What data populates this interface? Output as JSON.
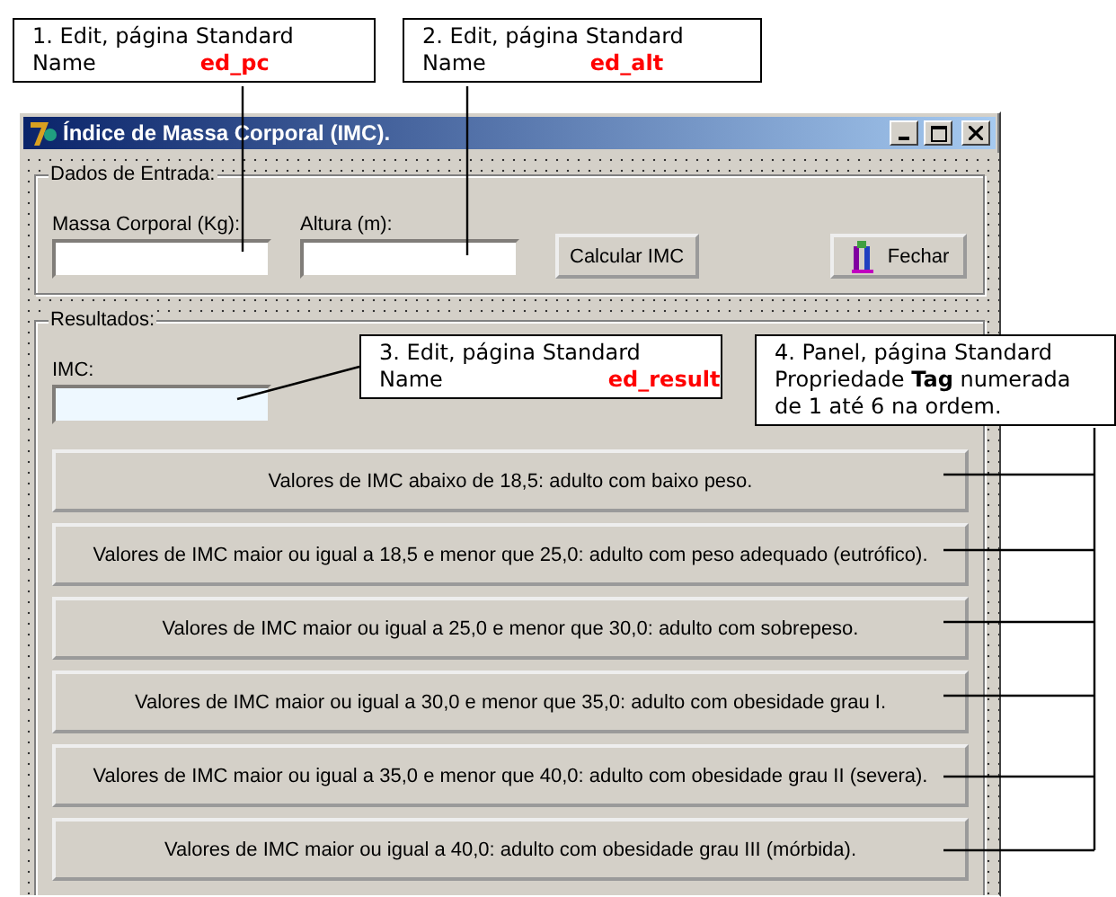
{
  "window": {
    "title": "Índice de Massa Corporal (IMC)."
  },
  "input_group": {
    "legend": "Dados de Entrada:",
    "fields": [
      {
        "label": "Massa Corporal (Kg):"
      },
      {
        "label": "Altura (m):"
      }
    ],
    "buttons": [
      {
        "label": "Calcular IMC",
        "kind": "plain"
      },
      {
        "label": "Fechar",
        "kind": "icon"
      }
    ]
  },
  "results_group": {
    "legend": "Resultados:",
    "field": {
      "label": "IMC:"
    },
    "panels": [
      "Valores de IMC abaixo de 18,5: adulto com baixo peso.",
      "Valores de IMC maior ou igual a 18,5 e menor que 25,0: adulto com peso adequado (eutrófico).",
      "Valores de IMC maior ou igual a 25,0 e menor que 30,0: adulto com sobrepeso.",
      "Valores de IMC maior ou igual a 30,0 e menor que 35,0: adulto com obesidade grau I.",
      "Valores de IMC maior ou igual a 35,0 e menor que 40,0: adulto com obesidade grau II (severa).",
      "Valores de IMC maior ou igual a 40,0: adulto com obesidade grau III (mórbida)."
    ]
  },
  "annotations": [
    {
      "lines": [
        "1. Edit, página Standard"
      ],
      "name_label": "Name",
      "name_value": "ed_pc"
    },
    {
      "lines": [
        "2. Edit, página Standard"
      ],
      "name_label": "Name",
      "name_value": "ed_alt"
    },
    {
      "lines": [
        "3. Edit, página Standard"
      ],
      "name_label": "Name",
      "name_value": "ed_result"
    },
    {
      "lines": [
        "4. Panel, página Standard",
        "Propriedade **Tag** numerada",
        "de 1 até 6 na ordem."
      ]
    }
  ]
}
